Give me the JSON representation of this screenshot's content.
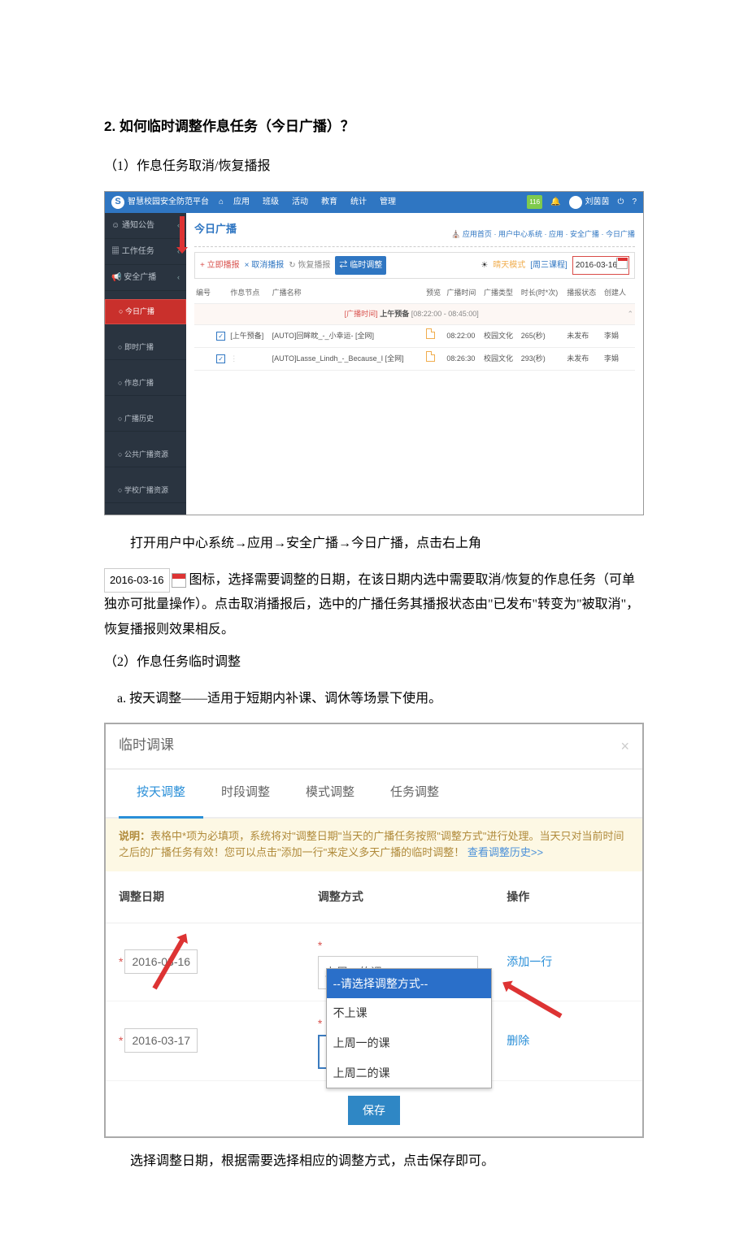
{
  "doc": {
    "heading": "2. 如何临时调整作息任务（今日广播）？",
    "sub1": "（1）作息任务取消/恢复播报",
    "para1a": "打开用户中心系统→应用→安全广播→今日广播，点击右上角",
    "inline_date": "2016-03-16",
    "para1b": "图标，选择需要调整的日期，在该日期内选中需要取消/恢复的作息任务（可单独亦可批量操作）。点击取消播报后，选中的广播任务其播报状态由\"已发布\"转变为\"被取消\"，恢复播报则效果相反。",
    "sub2": "（2）作息任务临时调整",
    "sub2a": "a. 按天调整——适用于短期内补课、调休等场景下使用。",
    "para2": "选择调整日期，根据需要选择相应的调整方式，点击保存即可。"
  },
  "shot1": {
    "logo": "智慧校园安全防范平台",
    "home_icon": "⌂",
    "topnav": [
      "应用",
      "班级",
      "活动",
      "教育",
      "统计",
      "管理"
    ],
    "badge": "116",
    "user": "刘茵茵",
    "side": [
      {
        "label": "通知公告",
        "sub": false
      },
      {
        "label": "工作任务",
        "sub": false
      },
      {
        "label": "安全广播",
        "sub": false
      },
      {
        "label": "今日广播",
        "sub": true,
        "active": true
      },
      {
        "label": "即时广播",
        "sub": true
      },
      {
        "label": "作息广播",
        "sub": true
      },
      {
        "label": "广播历史",
        "sub": true
      },
      {
        "label": "公共广播资源",
        "sub": true
      },
      {
        "label": "学校广播资源",
        "sub": true
      }
    ],
    "page_title": "今日广播",
    "breadcrumb": [
      "应用首页",
      "用户中心系统",
      "应用",
      "安全广播",
      "今日广播"
    ],
    "toolbar": {
      "add": "+ 立即播报",
      "cancel": "× 取消播报",
      "restore": "↻ 恢复播报",
      "adjust": "⇄ 临时调整",
      "mode_label": "晴天模式",
      "mode_link": "[周三课程]",
      "date": "2016-03-16"
    },
    "cols": [
      "编号",
      "",
      "作息节点",
      "广播名称",
      "预览",
      "广播时间",
      "广播类型",
      "时长(时*次)",
      "播报状态",
      "创建人"
    ],
    "seg_label": "[广播时间]",
    "seg_name": "上午预备",
    "seg_time": "[08:22:00 - 08:45:00]",
    "rows": [
      {
        "node": "[上午预备]",
        "name": "[AUTO]回眸眈_-_小幸运- [全网]",
        "time": "08:22:00",
        "type": "校园文化",
        "dur": "265(秒)",
        "state": "未发布",
        "creator": "李娟"
      },
      {
        "node": "",
        "name": "[AUTO]Lasse_Lindh_-_Because_I [全网]",
        "time": "08:26:30",
        "type": "校园文化",
        "dur": "293(秒)",
        "state": "未发布",
        "creator": "李娟"
      }
    ]
  },
  "shot2": {
    "title": "临时调课",
    "tabs": [
      "按天调整",
      "时段调整",
      "模式调整",
      "任务调整"
    ],
    "note_prefix": "说明：",
    "note_body": "表格中*项为必填项，系统将对\"调整日期\"当天的广播任务按照\"调整方式\"进行处理。当天只对当前时间之后的广播任务有效！您可以点击\"添加一行\"来定义多天广播的临时调整！",
    "note_link": "查看调整历史>>",
    "th": [
      "调整日期",
      "调整方式",
      "操作"
    ],
    "row1": {
      "date": "2016-03-16",
      "mode": "上周一的课",
      "action": "添加一行"
    },
    "row2": {
      "date": "2016-03-17",
      "mode": "--请选择调整方式--",
      "action": "删除"
    },
    "dropdown": [
      "--请选择调整方式--",
      "不上课",
      "上周一的课",
      "上周二的课"
    ],
    "save": "保存"
  }
}
